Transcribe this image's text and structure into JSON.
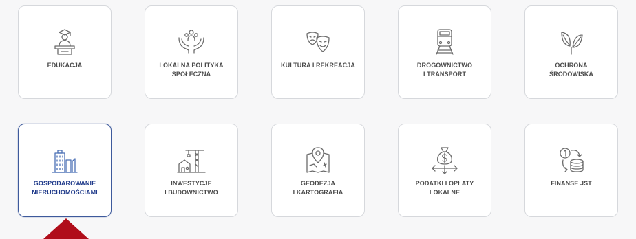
{
  "tiles": [
    {
      "label": "EDUKACJA",
      "icon": "teacher-podium-icon"
    },
    {
      "label": "LOKALNA POLITYKA\nSPOŁECZNA",
      "icon": "hands-family-icon"
    },
    {
      "label": "KULTURA I REKREACJA",
      "icon": "theater-masks-icon"
    },
    {
      "label": "DROGOWNICTWO\nI TRANSPORT",
      "icon": "train-icon"
    },
    {
      "label": "OCHRONA\nŚRODOWISKA",
      "icon": "leaves-icon"
    },
    {
      "label": "GOSPODAROWANIE\nNIERUCHOMOŚCIAMI",
      "icon": "buildings-icon"
    },
    {
      "label": "INWESTYCJE\nI BUDOWNICTWO",
      "icon": "crane-construction-icon"
    },
    {
      "label": "GEODEZJA\nI KARTOGRAFIA",
      "icon": "map-pin-icon"
    },
    {
      "label": "PODATKI I OPŁATY\nLOKALNE",
      "icon": "money-bag-arrows-icon"
    },
    {
      "label": "FINANSE JST",
      "icon": "coins-stack-icon"
    }
  ],
  "active_tile": "GOSPODAROWANIE\nNIERUCHOMOŚCIAMI",
  "colors": {
    "tile_border": "#d6d8dc",
    "active_border": "#3e5a9c",
    "active_text": "#1f3a8a",
    "icon_gray": "#6b6b6b",
    "icon_blue": "#4a6fb5",
    "arrow_red": "#b00d1a"
  }
}
